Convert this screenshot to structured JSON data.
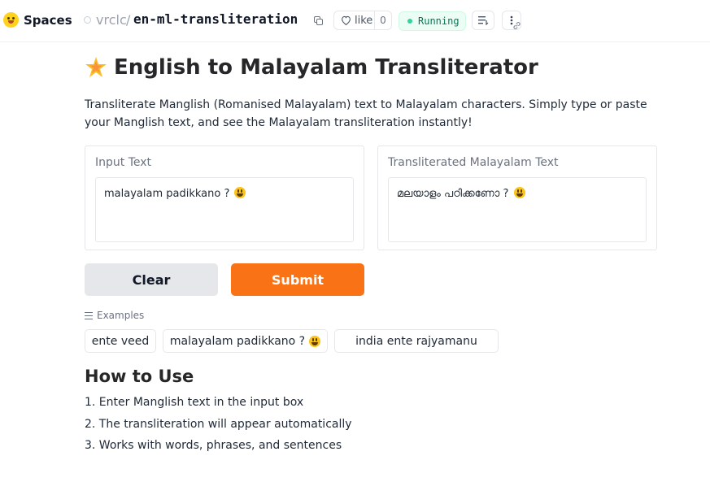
{
  "header": {
    "spaces_label": "Spaces",
    "owner": "vrclc",
    "separator": "/",
    "repo": "en-ml-transliteration",
    "like_label": "like",
    "like_count": "0",
    "status": "Running",
    "status_color": "#047857"
  },
  "main": {
    "title": "English to Malayalam Transliterator",
    "description": "Transliterate Manglish (Romanised Malayalam) text to Malayalam characters. Simply type or paste your Manglish text, and see the Malayalam transliteration instantly!",
    "input": {
      "label": "Input Text",
      "value": "malayalam  padikkano ?"
    },
    "output": {
      "label": "Transliterated Malayalam Text",
      "value": "മലയാളം  പഠിക്കണോ ?"
    },
    "buttons": {
      "clear": "Clear",
      "submit": "Submit",
      "submit_color": "#f97316"
    },
    "examples": {
      "label": "Examples",
      "items": [
        "ente veed",
        "malayalam padikkano ?",
        "india ente rajyamanu"
      ]
    },
    "how_to": {
      "title": "How to Use",
      "steps": [
        "1. Enter Manglish text in the input box",
        "2. The transliteration will appear automatically",
        "3. Works with words, phrases, and sentences"
      ]
    }
  }
}
